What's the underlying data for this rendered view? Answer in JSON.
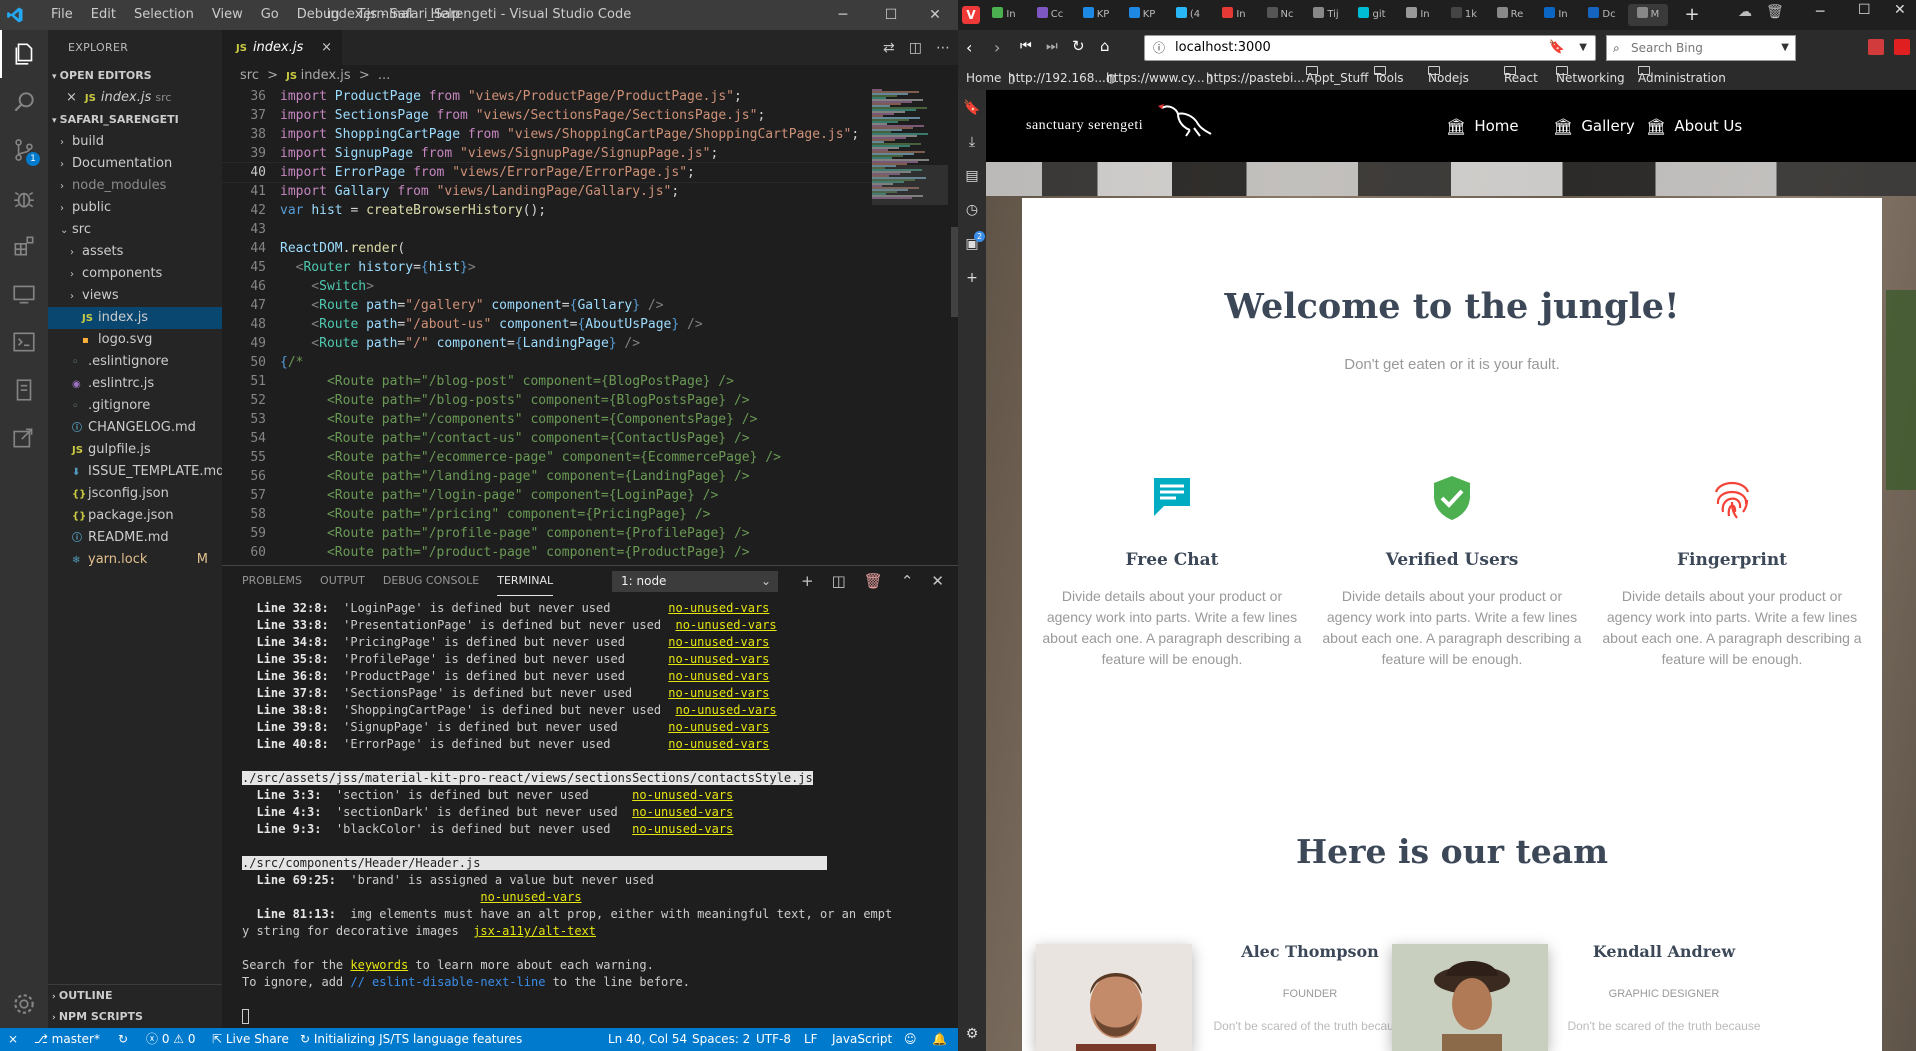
{
  "vscode": {
    "menu": [
      "File",
      "Edit",
      "Selection",
      "View",
      "Go",
      "Debug",
      "Terminal",
      "Help"
    ],
    "window_title": "index.js - Safari_Sarengeti - Visual Studio Code",
    "explorer": {
      "title": "EXPLORER",
      "open_editors": "OPEN EDITORS",
      "open_file": "index.js",
      "open_file_dir": "src",
      "project": "SAFARI_SARENGETI",
      "items": [
        {
          "label": "build",
          "type": "folder",
          "depth": 1,
          "open": false
        },
        {
          "label": "Documentation",
          "type": "folder",
          "depth": 1,
          "open": false
        },
        {
          "label": "node_modules",
          "type": "folder",
          "depth": 1,
          "open": false,
          "dim": true
        },
        {
          "label": "public",
          "type": "folder",
          "depth": 1,
          "open": false
        },
        {
          "label": "src",
          "type": "folder",
          "depth": 1,
          "open": true
        },
        {
          "label": "assets",
          "type": "folder",
          "depth": 2,
          "open": false
        },
        {
          "label": "components",
          "type": "folder",
          "depth": 2,
          "open": false
        },
        {
          "label": "views",
          "type": "folder",
          "depth": 2,
          "open": false
        },
        {
          "label": "index.js",
          "type": "js",
          "depth": 2,
          "selected": true
        },
        {
          "label": "logo.svg",
          "type": "svg",
          "depth": 2
        },
        {
          "label": ".eslintignore",
          "type": "dot",
          "depth": 1
        },
        {
          "label": ".eslintrc.js",
          "type": "eslint",
          "depth": 1
        },
        {
          "label": ".gitignore",
          "type": "dot",
          "depth": 1
        },
        {
          "label": "CHANGELOG.md",
          "type": "info",
          "depth": 1
        },
        {
          "label": "gulpfile.js",
          "type": "js",
          "depth": 1
        },
        {
          "label": "ISSUE_TEMPLATE.md",
          "type": "md",
          "depth": 1
        },
        {
          "label": "jsconfig.json",
          "type": "json",
          "depth": 1
        },
        {
          "label": "package.json",
          "type": "json",
          "depth": 1
        },
        {
          "label": "README.md",
          "type": "info",
          "depth": 1
        },
        {
          "label": "yarn.lock",
          "type": "yarn",
          "depth": 1,
          "badge": "M"
        }
      ],
      "outline": "OUTLINE",
      "npm_scripts": "NPM SCRIPTS"
    },
    "tab": {
      "label": "index.js",
      "js": "JS",
      "close": "×"
    },
    "breadcrumb": {
      "dir": "src",
      "sep": ">",
      "file": "index.js",
      "more": "..."
    },
    "code": [
      {
        "n": "36",
        "t": [
          [
            "kw",
            "import "
          ],
          [
            "id",
            "ProductPage "
          ],
          [
            "kw",
            "from "
          ],
          [
            "st",
            "\"views/ProductPage/ProductPage.js\""
          ],
          [
            "tx",
            ";"
          ]
        ]
      },
      {
        "n": "37",
        "t": [
          [
            "kw",
            "import "
          ],
          [
            "id",
            "SectionsPage "
          ],
          [
            "kw",
            "from "
          ],
          [
            "st",
            "\"views/SectionsPage/SectionsPage.js\""
          ],
          [
            "tx",
            ";"
          ]
        ]
      },
      {
        "n": "38",
        "t": [
          [
            "kw",
            "import "
          ],
          [
            "id",
            "ShoppingCartPage "
          ],
          [
            "kw",
            "from "
          ],
          [
            "st",
            "\"views/ShoppingCartPage/ShoppingCartPage.js\""
          ],
          [
            "tx",
            ";"
          ]
        ]
      },
      {
        "n": "39",
        "t": [
          [
            "kw",
            "import "
          ],
          [
            "id",
            "SignupPage "
          ],
          [
            "kw",
            "from "
          ],
          [
            "st",
            "\"views/SignupPage/SignupPage.js\""
          ],
          [
            "tx",
            ";"
          ]
        ]
      },
      {
        "n": "40",
        "t": [
          [
            "kw",
            "import "
          ],
          [
            "id",
            "ErrorPage "
          ],
          [
            "kw",
            "from "
          ],
          [
            "st",
            "\"views/ErrorPage/ErrorPage.js\""
          ],
          [
            "tx",
            ";"
          ]
        ],
        "cur": true
      },
      {
        "n": "41",
        "t": [
          [
            "kw",
            "import "
          ],
          [
            "id",
            "Gallary "
          ],
          [
            "kw",
            "from "
          ],
          [
            "st",
            "\"views/LandingPage/Gallary.js\""
          ],
          [
            "tx",
            ";"
          ]
        ]
      },
      {
        "n": "42",
        "t": [
          [
            "vr",
            "var "
          ],
          [
            "id",
            "hist "
          ],
          [
            "tx",
            "= "
          ],
          [
            "fn",
            "createBrowserHistory"
          ],
          [
            "tx",
            "();"
          ]
        ]
      },
      {
        "n": "43",
        "t": []
      },
      {
        "n": "44",
        "t": [
          [
            "id",
            "ReactDOM"
          ],
          [
            "tx",
            "."
          ],
          [
            "fn",
            "render"
          ],
          [
            "tx",
            "("
          ]
        ]
      },
      {
        "n": "45",
        "t": [
          [
            "pu",
            "  <"
          ],
          [
            "tg",
            "Router "
          ],
          [
            "id",
            "history"
          ],
          [
            "tx",
            "="
          ],
          [
            "vr",
            "{"
          ],
          [
            "id",
            "hist"
          ],
          [
            "vr",
            "}"
          ],
          [
            "pu",
            ">"
          ]
        ]
      },
      {
        "n": "46",
        "t": [
          [
            "pu",
            "    <"
          ],
          [
            "tg",
            "Switch"
          ],
          [
            "pu",
            ">"
          ]
        ]
      },
      {
        "n": "47",
        "t": [
          [
            "pu",
            "    <"
          ],
          [
            "tg",
            "Route "
          ],
          [
            "id",
            "path"
          ],
          [
            "tx",
            "="
          ],
          [
            "st",
            "\"/gallery\" "
          ],
          [
            "id",
            "component"
          ],
          [
            "tx",
            "="
          ],
          [
            "vr",
            "{"
          ],
          [
            "id",
            "Gallary"
          ],
          [
            "vr",
            "}"
          ],
          [
            "pu",
            " />"
          ]
        ]
      },
      {
        "n": "48",
        "t": [
          [
            "pu",
            "    <"
          ],
          [
            "tg",
            "Route "
          ],
          [
            "id",
            "path"
          ],
          [
            "tx",
            "="
          ],
          [
            "st",
            "\"/about-us\" "
          ],
          [
            "id",
            "component"
          ],
          [
            "tx",
            "="
          ],
          [
            "vr",
            "{"
          ],
          [
            "id",
            "AboutUsPage"
          ],
          [
            "vr",
            "}"
          ],
          [
            "pu",
            " />"
          ]
        ]
      },
      {
        "n": "49",
        "t": [
          [
            "pu",
            "    <"
          ],
          [
            "tg",
            "Route "
          ],
          [
            "id",
            "path"
          ],
          [
            "tx",
            "="
          ],
          [
            "st",
            "\"/\" "
          ],
          [
            "id",
            "component"
          ],
          [
            "tx",
            "="
          ],
          [
            "vr",
            "{"
          ],
          [
            "id",
            "LandingPage"
          ],
          [
            "vr",
            "}"
          ],
          [
            "pu",
            " />"
          ]
        ]
      },
      {
        "n": "50",
        "t": [
          [
            "vr",
            "{"
          ],
          [
            "cm",
            "/*"
          ]
        ]
      },
      {
        "n": "51",
        "t": [
          [
            "cm",
            "      <Route path=\"/blog-post\" component={BlogPostPage} />"
          ]
        ]
      },
      {
        "n": "52",
        "t": [
          [
            "cm",
            "      <Route path=\"/blog-posts\" component={BlogPostsPage} />"
          ]
        ]
      },
      {
        "n": "53",
        "t": [
          [
            "cm",
            "      <Route path=\"/components\" component={ComponentsPage} />"
          ]
        ]
      },
      {
        "n": "54",
        "t": [
          [
            "cm",
            "      <Route path=\"/contact-us\" component={ContactUsPage} />"
          ]
        ]
      },
      {
        "n": "55",
        "t": [
          [
            "cm",
            "      <Route path=\"/ecommerce-page\" component={EcommercePage} />"
          ]
        ]
      },
      {
        "n": "56",
        "t": [
          [
            "cm",
            "      <Route path=\"/landing-page\" component={LandingPage} />"
          ]
        ]
      },
      {
        "n": "57",
        "t": [
          [
            "cm",
            "      <Route path=\"/login-page\" component={LoginPage} />"
          ]
        ]
      },
      {
        "n": "58",
        "t": [
          [
            "cm",
            "      <Route path=\"/pricing\" component={PricingPage} />"
          ]
        ]
      },
      {
        "n": "59",
        "t": [
          [
            "cm",
            "      <Route path=\"/profile-page\" component={ProfilePage} />"
          ]
        ]
      },
      {
        "n": "60",
        "t": [
          [
            "cm",
            "      <Route path=\"/product-page\" component={ProductPage} />"
          ]
        ]
      }
    ],
    "panel": {
      "tabs": [
        "PROBLEMS",
        "OUTPUT",
        "DEBUG CONSOLE",
        "TERMINAL"
      ],
      "active": "TERMINAL",
      "select": "1: node"
    },
    "terminal": [
      [
        [
          "b",
          "  Line 32:8:  "
        ],
        [
          "t",
          "'LoginPage' is defined but never used        "
        ],
        [
          "r",
          "no-unused-vars"
        ]
      ],
      [
        [
          "b",
          "  Line 33:8:  "
        ],
        [
          "t",
          "'PresentationPage' is defined but never used  "
        ],
        [
          "r",
          "no-unused-vars"
        ]
      ],
      [
        [
          "b",
          "  Line 34:8:  "
        ],
        [
          "t",
          "'PricingPage' is defined but never used      "
        ],
        [
          "r",
          "no-unused-vars"
        ]
      ],
      [
        [
          "b",
          "  Line 35:8:  "
        ],
        [
          "t",
          "'ProfilePage' is defined but never used      "
        ],
        [
          "r",
          "no-unused-vars"
        ]
      ],
      [
        [
          "b",
          "  Line 36:8:  "
        ],
        [
          "t",
          "'ProductPage' is defined but never used      "
        ],
        [
          "r",
          "no-unused-vars"
        ]
      ],
      [
        [
          "b",
          "  Line 37:8:  "
        ],
        [
          "t",
          "'SectionsPage' is defined but never used     "
        ],
        [
          "r",
          "no-unused-vars"
        ]
      ],
      [
        [
          "b",
          "  Line 38:8:  "
        ],
        [
          "t",
          "'ShoppingCartPage' is defined but never used  "
        ],
        [
          "r",
          "no-unused-vars"
        ]
      ],
      [
        [
          "b",
          "  Line 39:8:  "
        ],
        [
          "t",
          "'SignupPage' is defined but never used       "
        ],
        [
          "r",
          "no-unused-vars"
        ]
      ],
      [
        [
          "b",
          "  Line 40:8:  "
        ],
        [
          "t",
          "'ErrorPage' is defined but never used        "
        ],
        [
          "r",
          "no-unused-vars"
        ]
      ],
      [],
      [
        [
          "h",
          "./src/assets/jss/material-kit-pro-react/views/sectionsSections/contactsStyle.js"
        ]
      ],
      [
        [
          "b",
          "  Line 3:3:  "
        ],
        [
          "t",
          "'section' is defined but never used      "
        ],
        [
          "r",
          "no-unused-vars"
        ]
      ],
      [
        [
          "b",
          "  Line 4:3:  "
        ],
        [
          "t",
          "'sectionDark' is defined but never used  "
        ],
        [
          "r",
          "no-unused-vars"
        ]
      ],
      [
        [
          "b",
          "  Line 9:3:  "
        ],
        [
          "t",
          "'blackColor' is defined but never used   "
        ],
        [
          "r",
          "no-unused-vars"
        ]
      ],
      [],
      [
        [
          "h",
          "./src/components/Header/Header.js                                                "
        ]
      ],
      [
        [
          "b",
          "  Line 69:25:  "
        ],
        [
          "t",
          "'brand' is assigned a value but never used"
        ]
      ],
      [
        [
          "t",
          "                                 "
        ],
        [
          "r",
          "no-unused-vars"
        ]
      ],
      [
        [
          "b",
          "  Line 81:13:  "
        ],
        [
          "t",
          "img elements must have an alt prop, either with meaningful text, or an empt"
        ]
      ],
      [
        [
          "t",
          "y string for decorative images  "
        ],
        [
          "r",
          "jsx-a11y/alt-text"
        ]
      ],
      [],
      [
        [
          "t",
          "Search for the "
        ],
        [
          "k",
          "keywords"
        ],
        [
          "t",
          " to learn more about each warning."
        ]
      ],
      [
        [
          "t",
          "To ignore, add "
        ],
        [
          "c",
          "// eslint-disable-next-line"
        ],
        [
          "t",
          " to the line before."
        ]
      ],
      [],
      [
        [
          "cur",
          ""
        ]
      ]
    ],
    "status": {
      "branch": "master*",
      "errors": "0",
      "warnings": "0",
      "live_share": "Live Share",
      "progress": "Initializing JS/TS language features",
      "position": "Ln 40, Col 54",
      "spaces": "Spaces: 2",
      "encoding": "UTF-8",
      "eol": "LF",
      "language": "JavaScript"
    },
    "scm_badge": "1"
  },
  "browser": {
    "url": "localhost:3000",
    "search_placeholder": "Search Bing",
    "tab_labels": [
      "In",
      "Cc",
      "KP",
      "KP",
      "(4",
      "In",
      "Nc",
      "Tij",
      "git",
      "In",
      "1k",
      "Re",
      "In",
      "Dc",
      "M"
    ],
    "sidebar_badge": "2",
    "bookmarks": [
      {
        "label": "Home",
        "icon": "home"
      },
      {
        "label": "http://192.168....",
        "icon": "page"
      },
      {
        "label": "https://www.cy...",
        "icon": "globe"
      },
      {
        "label": "https://pastebi...",
        "icon": "page"
      },
      {
        "label": "Appt_Stuff",
        "icon": "folder"
      },
      {
        "label": "Tools",
        "icon": "folder"
      },
      {
        "label": "Nodejs",
        "icon": "folder"
      },
      {
        "label": "React",
        "icon": "folder"
      },
      {
        "label": "Networking",
        "icon": "folder"
      },
      {
        "label": "Administration",
        "icon": "folder"
      }
    ],
    "page": {
      "brand": "sanctuary serengeti",
      "nav": [
        "Home",
        "Gallery",
        "About Us"
      ],
      "title": "Welcome to the jungle!",
      "subtitle": "Don't get eaten or it is your fault.",
      "features": [
        {
          "icon": "chat-icon",
          "title": "Free Chat",
          "desc": "Divide details about your product or agency work into parts. Write a few lines about each one. A paragraph describing a feature will be enough.",
          "color": "#00acc1"
        },
        {
          "icon": "verified-shield-icon",
          "title": "Verified Users",
          "desc": "Divide details about your product or agency work into parts. Write a few lines about each one. A paragraph describing a feature will be enough.",
          "color": "#4caf50"
        },
        {
          "icon": "fingerprint-icon",
          "title": "Fingerprint",
          "desc": "Divide details about your product or agency work into parts. Write a few lines about each one. A paragraph describing a feature will be enough.",
          "color": "#f44336"
        }
      ],
      "team_title": "Here is our team",
      "team": [
        {
          "name": "Alec Thompson",
          "role": "FOUNDER",
          "text": "Don't be scared of the truth because"
        },
        {
          "name": "Kendall Andrew",
          "role": "GRAPHIC DESIGNER",
          "text": "Don't be scared of the truth because"
        }
      ]
    }
  }
}
